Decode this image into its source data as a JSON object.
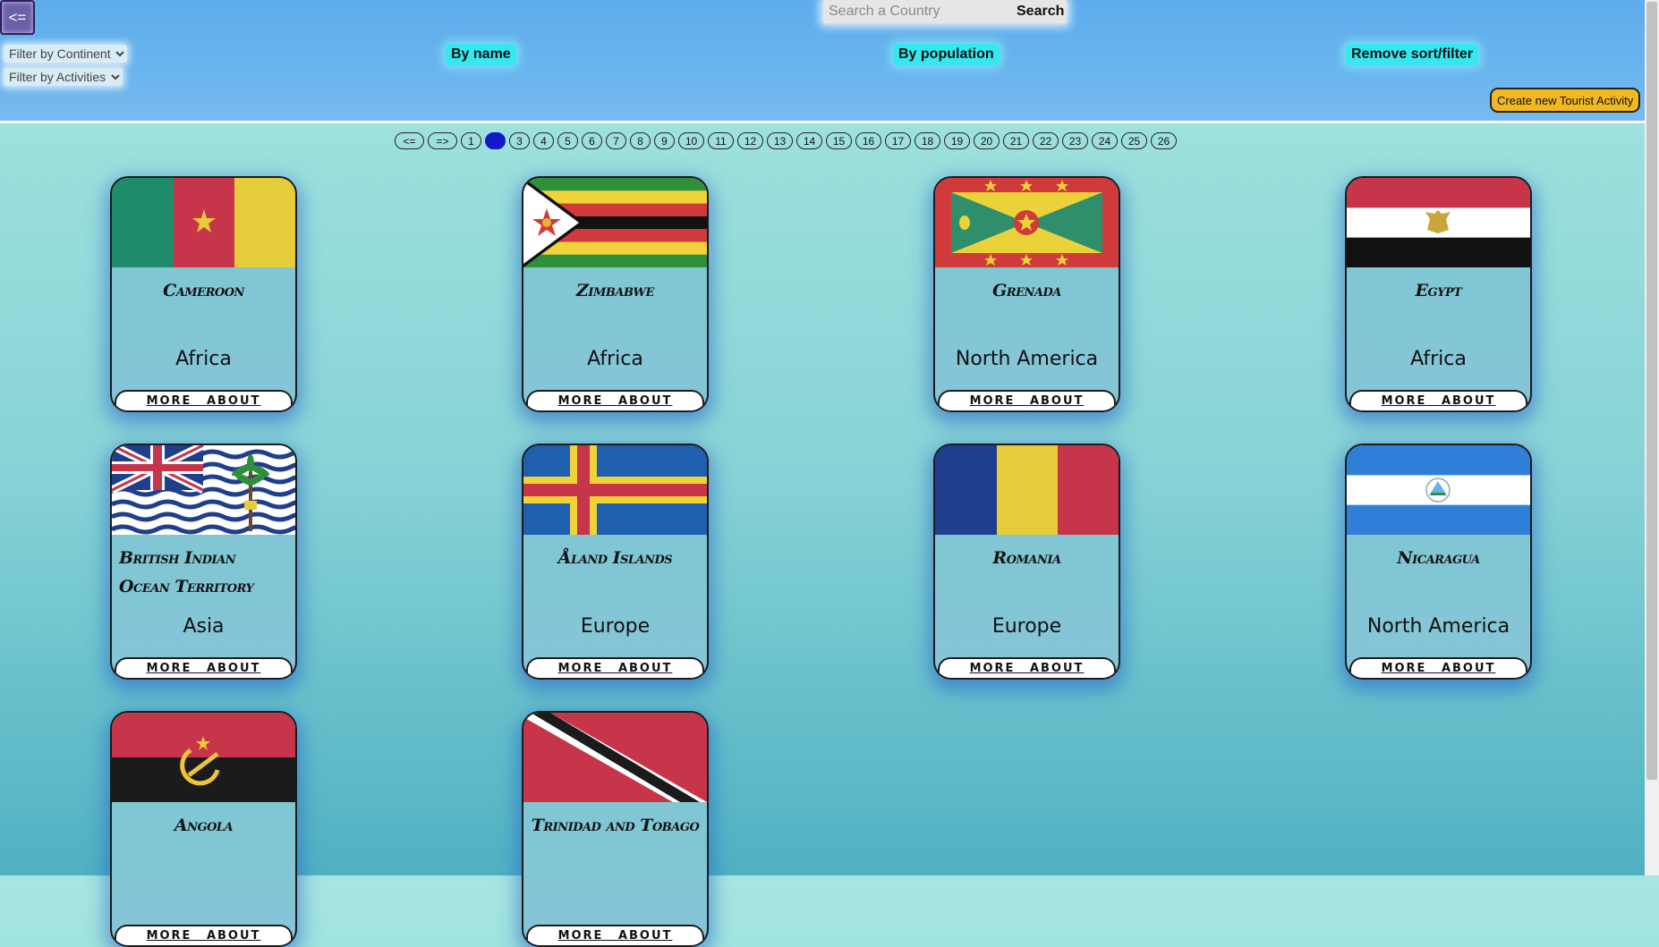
{
  "header": {
    "back_label": "<=",
    "search_placeholder": "Search a Country",
    "search_button": "Search",
    "filter_continent": "Filter by Continent",
    "filter_activities": "Filter by Activities",
    "sort_by_name": "By name",
    "sort_by_population": "By population",
    "remove_sort_filter": "Remove sort/filter",
    "create_activity": "Create new Tourist Activity"
  },
  "pagination": {
    "prev": "<=",
    "next": "=>",
    "pages": [
      "1",
      "2",
      "3",
      "4",
      "5",
      "6",
      "7",
      "8",
      "9",
      "10",
      "11",
      "12",
      "13",
      "14",
      "15",
      "16",
      "17",
      "18",
      "19",
      "20",
      "21",
      "22",
      "23",
      "24",
      "25",
      "26"
    ],
    "current": "2"
  },
  "more_label": "MORE ABOUT",
  "countries": [
    {
      "name": "Cameroon",
      "continent": "Africa",
      "flag": "cameroon-flag"
    },
    {
      "name": "Zimbabwe",
      "continent": "Africa",
      "flag": "zimbabwe-flag"
    },
    {
      "name": "Grenada",
      "continent": "North America",
      "flag": "grenada-flag"
    },
    {
      "name": "Egypt",
      "continent": "Africa",
      "flag": "egypt-flag"
    },
    {
      "name": "British Indian Ocean Territory",
      "continent": "Asia",
      "flag": "biot-flag"
    },
    {
      "name": "Åland Islands",
      "continent": "Europe",
      "flag": "aland-flag"
    },
    {
      "name": "Romania",
      "continent": "Europe",
      "flag": "romania-flag"
    },
    {
      "name": "Nicaragua",
      "continent": "North America",
      "flag": "nicaragua-flag"
    },
    {
      "name": "Angola",
      "continent": "",
      "flag": "angola-flag"
    },
    {
      "name": "Trinidad and Tobago",
      "continent": "",
      "flag": "trinidad-flag"
    }
  ]
}
